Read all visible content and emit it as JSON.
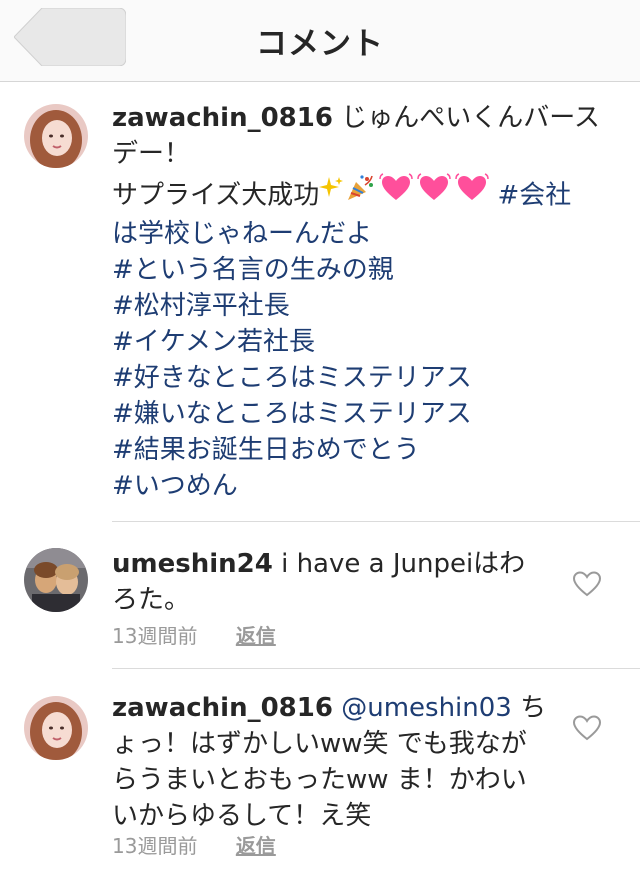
{
  "header": {
    "title": "コメント"
  },
  "caption": {
    "username": "zawachin_0816",
    "line1_text": "じゅんぺいくんバース",
    "line2_text": "デー！",
    "line3_text": "サプライズ大成功",
    "line3_tag": "#会社",
    "line4_tag": "は学校じゃねーんだよ",
    "hashtags": [
      "#という名言の生みの親",
      "#松村淳平社長",
      "#イケメン若社長",
      "#好きなところはミステリアス",
      "#嫌いなところはミステリアス",
      "#結果お誕生日おめでとう",
      "#いつめん"
    ]
  },
  "comments": [
    {
      "username": "umeshin24",
      "line1_text": "i have a Junpeiはわ",
      "line2_text": "ろた。",
      "time": "13週間前",
      "reply_label": "返信"
    },
    {
      "username": "zawachin_0816",
      "mention": "@umeshin03",
      "line1_text": "ち",
      "line2_text": "ょっ！はずかしいww笑 でも我なが",
      "line3_text": "らうまいとおもったww ま！かわい",
      "line4_text": "いからゆるして！え笑",
      "time": "13週間前",
      "reply_label": "返信"
    }
  ],
  "colors": {
    "hashtag": "#1e3d73",
    "heart_outline": "#9a9a9a",
    "header_bg": "#fafafa"
  },
  "icons": [
    "back-arrow-icon",
    "sparkles-icon",
    "party-popper-icon",
    "pink-heart-icon",
    "heart-outline-icon"
  ]
}
